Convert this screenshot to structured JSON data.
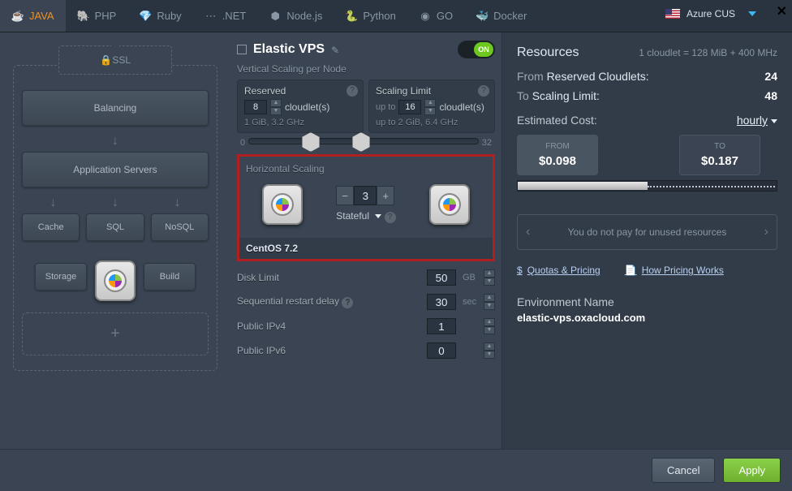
{
  "tabs": {
    "java": "JAVA",
    "php": "PHP",
    "ruby": "Ruby",
    "dotnet": ".NET",
    "nodejs": "Node.js",
    "python": "Python",
    "go": "GO",
    "docker": "Docker"
  },
  "region": {
    "label": "Azure CUS"
  },
  "left": {
    "ssl": "SSL",
    "balancing": "Balancing",
    "appservers": "Application Servers",
    "cache": "Cache",
    "sql": "SQL",
    "nosql": "NoSQL",
    "storage": "Storage",
    "build": "Build",
    "plus": "+"
  },
  "vps": {
    "title": "Elastic VPS",
    "toggle": "ON",
    "vscale_label": "Vertical Scaling per Node",
    "reserved": {
      "label": "Reserved",
      "value": "8",
      "unit": "cloudlet(s)",
      "spec": "1 GiB, 3.2 GHz"
    },
    "limit": {
      "label": "Scaling Limit",
      "upto": "up to",
      "value": "16",
      "unit": "cloudlet(s)",
      "spec_prefix": "up to",
      "spec": "2 GiB, 6.4 GHz"
    },
    "slider": {
      "min": "0",
      "max": "32"
    },
    "hscale": {
      "label": "Horizontal Scaling",
      "count": "3",
      "mode": "Stateful",
      "os": "CentOS 7.2"
    },
    "disk": {
      "label": "Disk Limit",
      "value": "50",
      "unit": "GB"
    },
    "restart": {
      "label": "Sequential restart delay",
      "value": "30",
      "unit": "sec"
    },
    "ipv4": {
      "label": "Public IPv4",
      "value": "1"
    },
    "ipv6": {
      "label": "Public IPv6",
      "value": "0"
    }
  },
  "resources": {
    "title": "Resources",
    "cloudlet_def": "1 cloudlet = 128 MiB + 400 MHz",
    "from_lbl": "From",
    "from_txt": "Reserved Cloudlets:",
    "from_val": "24",
    "to_lbl": "To",
    "to_txt": "Scaling Limit:",
    "to_val": "48",
    "est_label": "Estimated Cost:",
    "period": "hourly",
    "from_price_lbl": "FROM",
    "from_price": "$0.098",
    "to_price_lbl": "TO",
    "to_price": "$0.187",
    "note": "You do not pay for unused resources",
    "quotas": "Quotas & Pricing",
    "how": "How Pricing Works",
    "env_label": "Environment Name",
    "env_name": "elastic-vps.oxacloud.com"
  },
  "footer": {
    "cancel": "Cancel",
    "apply": "Apply"
  }
}
